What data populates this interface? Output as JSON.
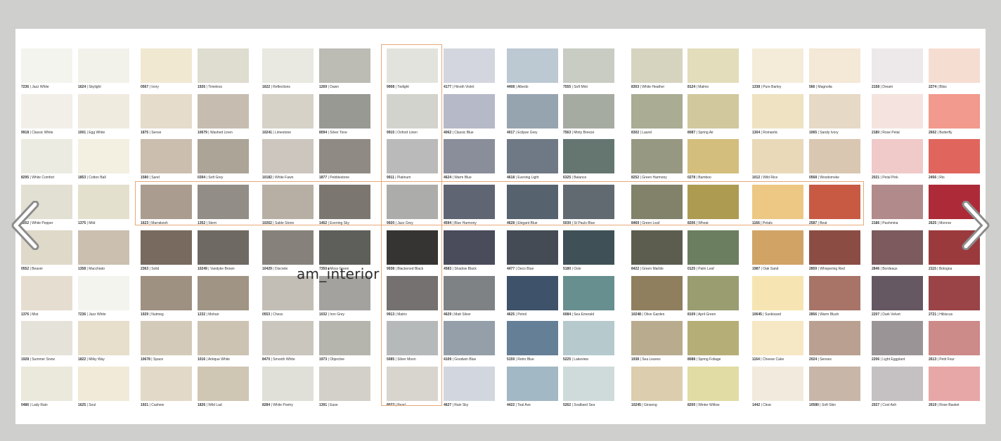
{
  "watermark": "am_interior",
  "nav": {
    "prev_icon": "chevron-left-icon",
    "next_icon": "chevron-right-icon"
  },
  "highlight_color": "#e7a979",
  "columns": [
    [
      {
        "code": "7236",
        "name": "Jazz White",
        "color": "#f4f4ee"
      },
      {
        "code": "9918",
        "name": "Classic White",
        "color": "#f2efe8"
      },
      {
        "code": "8295",
        "name": "White Comfort",
        "color": "#ecebe1"
      },
      {
        "code": "1002",
        "name": "White Pepper",
        "color": "#e2e0d2"
      },
      {
        "code": "0552",
        "name": "Beaver",
        "color": "#dfd9ca"
      },
      {
        "code": "1376",
        "name": "Mist",
        "color": "#e6ddd1"
      },
      {
        "code": "1928",
        "name": "Summer Snow",
        "color": "#e5e2d9"
      },
      {
        "code": "0486",
        "name": "Lady Rain",
        "color": "#ebe9dc"
      }
    ],
    [
      {
        "code": "1624",
        "name": "Skylight",
        "color": "#f3f2ea"
      },
      {
        "code": "1001",
        "name": "Egg White",
        "color": "#efebdf"
      },
      {
        "code": "1853",
        "name": "Cotton Ball",
        "color": "#f3efe1"
      },
      {
        "code": "1375",
        "name": "Mild",
        "color": "#e3e0ce"
      },
      {
        "code": "1358",
        "name": "Macchiato",
        "color": "#cbbfaf"
      },
      {
        "code": "7236",
        "name": "Jazz White",
        "color": "#f4f4ef"
      },
      {
        "code": "1822",
        "name": "Milky Way",
        "color": "#e7decb"
      },
      {
        "code": "1625",
        "name": "Soul",
        "color": "#f1ead9"
      }
    ],
    [
      {
        "code": "0567",
        "name": "Ivory",
        "color": "#f1e8d2"
      },
      {
        "code": "1875",
        "name": "Sense",
        "color": "#e6dccb"
      },
      {
        "code": "1580",
        "name": "Sand",
        "color": "#cbbeaf"
      },
      {
        "code": "1623",
        "name": "Marrakesh",
        "color": "#aa9d8f"
      },
      {
        "code": "2363",
        "name": "Solid",
        "color": "#786a5f"
      },
      {
        "code": "1929",
        "name": "Nutmeg",
        "color": "#9f9181"
      },
      {
        "code": "10678",
        "name": "Space",
        "color": "#d3cab9"
      },
      {
        "code": "1921",
        "name": "Cashew",
        "color": "#e2d9c8"
      }
    ],
    [
      {
        "code": "1926",
        "name": "Timeless",
        "color": "#dfdcd0"
      },
      {
        "code": "10679",
        "name": "Washed Linen",
        "color": "#c6bdb0"
      },
      {
        "code": "0394",
        "name": "Soft Grey",
        "color": "#aca497"
      },
      {
        "code": "1352",
        "name": "Stern",
        "color": "#928d86"
      },
      {
        "code": "10249",
        "name": "Vandyke Brown",
        "color": "#6f6963"
      },
      {
        "code": "1232",
        "name": "Mohair",
        "color": "#a09484"
      },
      {
        "code": "1016",
        "name": "Antique White",
        "color": "#cdc3b3"
      },
      {
        "code": "1826",
        "name": "Wild Lad",
        "color": "#cfc6b4"
      }
    ],
    [
      {
        "code": "1622",
        "name": "Reflections",
        "color": "#e9e8e1"
      },
      {
        "code": "10241",
        "name": "Limestone",
        "color": "#d6d2c7"
      },
      {
        "code": "10182",
        "name": "White Fawn",
        "color": "#ccc6be"
      },
      {
        "code": "10262",
        "name": "Sable Stone",
        "color": "#b7afa4"
      },
      {
        "code": "10429",
        "name": "Discrete",
        "color": "#86817a"
      },
      {
        "code": "0553",
        "name": "Chess",
        "color": "#c2beb6"
      },
      {
        "code": "8470",
        "name": "Smooth White",
        "color": "#cac6bd"
      },
      {
        "code": "8284",
        "name": "White Poetry",
        "color": "#e0e0d8"
      }
    ],
    [
      {
        "code": "1269",
        "name": "Dawn",
        "color": "#bcbbb4"
      },
      {
        "code": "8094",
        "name": "Silver Tone",
        "color": "#999994"
      },
      {
        "code": "1877",
        "name": "Pebblestone",
        "color": "#8f8b84"
      },
      {
        "code": "1462",
        "name": "Evening Sky",
        "color": "#7b7770"
      },
      {
        "code": "7350",
        "name": "Moss Green",
        "color": "#5e5f5a"
      },
      {
        "code": "1032",
        "name": "Iron Grey",
        "color": "#a3a29e"
      },
      {
        "code": "1973",
        "name": "Objective",
        "color": "#b5b5ad"
      },
      {
        "code": "1391",
        "name": "Ease",
        "color": "#d2d0c8"
      }
    ],
    [
      {
        "code": "9908",
        "name": "Twilight",
        "color": "#e3e3de"
      },
      {
        "code": "9915",
        "name": "Oxford Linen",
        "color": "#d3d3ce"
      },
      {
        "code": "9911",
        "name": "Platinum",
        "color": "#bababa"
      },
      {
        "code": "9920",
        "name": "Jazz Grey",
        "color": "#acacaa"
      },
      {
        "code": "9938",
        "name": "Blackened Black",
        "color": "#363432"
      },
      {
        "code": "9913",
        "name": "Matrix",
        "color": "#747170"
      },
      {
        "code": "5085",
        "name": "Silver Moon",
        "color": "#b5b9ba"
      },
      {
        "code": "8023",
        "name": "Pearl",
        "color": "#d8d5cf"
      }
    ],
    [
      {
        "code": "4177",
        "name": "Hinoth Violet",
        "color": "#d3d6df"
      },
      {
        "code": "4062",
        "name": "Classic Blue",
        "color": "#b6b9c7"
      },
      {
        "code": "4624",
        "name": "Warm Blue",
        "color": "#8a8e9b"
      },
      {
        "code": "4594",
        "name": "Blue Harmony",
        "color": "#5f6573"
      },
      {
        "code": "4583",
        "name": "Shadow Black",
        "color": "#4a4b5b"
      },
      {
        "code": "4629",
        "name": "Matt Silver",
        "color": "#7e8284"
      },
      {
        "code": "4109",
        "name": "Goodwin Blue",
        "color": "#959fa9"
      },
      {
        "code": "4627",
        "name": "Rain Sky",
        "color": "#d2d7df"
      }
    ],
    [
      {
        "code": "4408",
        "name": "Albedo",
        "color": "#bcc8d2"
      },
      {
        "code": "4017",
        "name": "Eclipse Grey",
        "color": "#96a4b0"
      },
      {
        "code": "4618",
        "name": "Evening Light",
        "color": "#6f7985"
      },
      {
        "code": "4628",
        "name": "Elegant Blue",
        "color": "#56636f"
      },
      {
        "code": "4477",
        "name": "Deco Blue",
        "color": "#444b55"
      },
      {
        "code": "4625",
        "name": "Petrol",
        "color": "#3e526a"
      },
      {
        "code": "5159",
        "name": "Retro Blue",
        "color": "#647f96"
      },
      {
        "code": "4422",
        "name": "Teal Ave",
        "color": "#a2b8c4"
      }
    ],
    [
      {
        "code": "7555",
        "name": "Soft Mint",
        "color": "#c8ccc3"
      },
      {
        "code": "7563",
        "name": "Minty Breeze",
        "color": "#a6aba2"
      },
      {
        "code": "6325",
        "name": "Balance",
        "color": "#657671"
      },
      {
        "code": "5030",
        "name": "St Pauls Blue",
        "color": "#606a70"
      },
      {
        "code": "5180",
        "name": "Oslo",
        "color": "#3f5156"
      },
      {
        "code": "6084",
        "name": "Sea Emerald",
        "color": "#688f8f"
      },
      {
        "code": "5225",
        "name": "Lakeview",
        "color": "#b6cace"
      },
      {
        "code": "5262",
        "name": "Svalbard Sea",
        "color": "#cfdbdb"
      }
    ],
    [
      {
        "code": "8303",
        "name": "White Heather",
        "color": "#d6d3bf"
      },
      {
        "code": "8302",
        "name": "Laurel",
        "color": "#aaac93"
      },
      {
        "code": "8252",
        "name": "Green Harmony",
        "color": "#979882"
      },
      {
        "code": "8469",
        "name": "Green Leaf",
        "color": "#828169"
      },
      {
        "code": "8422",
        "name": "Green Marble",
        "color": "#5d5d4f"
      },
      {
        "code": "10248",
        "name": "Olive Garden",
        "color": "#8f7f5f"
      },
      {
        "code": "1938",
        "name": "Sea Leaves",
        "color": "#b8ab8e"
      },
      {
        "code": "10245",
        "name": "Ginseng",
        "color": "#dccdae"
      }
    ],
    [
      {
        "code": "8124",
        "name": "Malmo",
        "color": "#e3ddbb"
      },
      {
        "code": "8087",
        "name": "Spring Air",
        "color": "#d1c89e"
      },
      {
        "code": "0278",
        "name": "Bamboo",
        "color": "#d3be7d"
      },
      {
        "code": "8206",
        "name": "Wheat",
        "color": "#ad9b52"
      },
      {
        "code": "0125",
        "name": "Palm Leaf",
        "color": "#6b7e5f"
      },
      {
        "code": "8109",
        "name": "April Green",
        "color": "#999d70"
      },
      {
        "code": "8088",
        "name": "Spring Foliage",
        "color": "#b6ae77"
      },
      {
        "code": "8200",
        "name": "Winter Willow",
        "color": "#e0dca3"
      }
    ],
    [
      {
        "code": "1338",
        "name": "Pure Barley",
        "color": "#f4ecd8"
      },
      {
        "code": "1304",
        "name": "Romantic",
        "color": "#eee2c2"
      },
      {
        "code": "1012",
        "name": "Wild Rice",
        "color": "#e9d9b9"
      },
      {
        "code": "1166",
        "name": "Petals",
        "color": "#edc885"
      },
      {
        "code": "1987",
        "name": "Oak Sand",
        "color": "#d1a466"
      },
      {
        "code": "10645",
        "name": "Sunkissed",
        "color": "#f6e5b3"
      },
      {
        "code": "1164",
        "name": "Cheese Cake",
        "color": "#f6e8c5"
      },
      {
        "code": "1442",
        "name": "Clear",
        "color": "#f2ebdd"
      }
    ],
    [
      {
        "code": "566",
        "name": "Magnolia",
        "color": "#f4e8d6"
      },
      {
        "code": "1065",
        "name": "Sandy Ivory",
        "color": "#e6d9c6"
      },
      {
        "code": "0568",
        "name": "Woodsmoke",
        "color": "#d9c7b2"
      },
      {
        "code": "2587",
        "name": "Beat",
        "color": "#c85a44"
      },
      {
        "code": "2859",
        "name": "Whispering Red",
        "color": "#8b4d43"
      },
      {
        "code": "2856",
        "name": "Warm Blush",
        "color": "#a87468"
      },
      {
        "code": "2024",
        "name": "Senses",
        "color": "#b9a090"
      },
      {
        "code": "10580",
        "name": "Soft Skin",
        "color": "#c8b6a8"
      }
    ],
    [
      {
        "code": "2158",
        "name": "Dream",
        "color": "#ede8e9"
      },
      {
        "code": "2180",
        "name": "Rose Petal",
        "color": "#f5e3df"
      },
      {
        "code": "2021",
        "name": "Petal Pink",
        "color": "#f0c9c9"
      },
      {
        "code": "2186",
        "name": "Pashmina",
        "color": "#b18a8b"
      },
      {
        "code": "2846",
        "name": "Bordeaux",
        "color": "#7c5a5d"
      },
      {
        "code": "2207",
        "name": "Dark Velvet",
        "color": "#665862"
      },
      {
        "code": "2206",
        "name": "Light Eggplant",
        "color": "#9a9497"
      },
      {
        "code": "2027",
        "name": "Cool Ash",
        "color": "#c5c0c2"
      }
    ],
    [
      {
        "code": "2274",
        "name": "Bliss",
        "color": "#f6ddd2"
      },
      {
        "code": "2602",
        "name": "Butterfly",
        "color": "#f29a8d"
      },
      {
        "code": "2456",
        "name": "Rio",
        "color": "#e0665d"
      },
      {
        "code": "2625",
        "name": "Monroe",
        "color": "#ad2b38"
      },
      {
        "code": "2115",
        "name": "Bologna",
        "color": "#9b3a3d"
      },
      {
        "code": "2721",
        "name": "Hibiscus",
        "color": "#9a4447"
      },
      {
        "code": "2613",
        "name": "Petit Four",
        "color": "#cc8a89"
      },
      {
        "code": "2619",
        "name": "Rose Basket",
        "color": "#e6a7a6"
      }
    ]
  ]
}
